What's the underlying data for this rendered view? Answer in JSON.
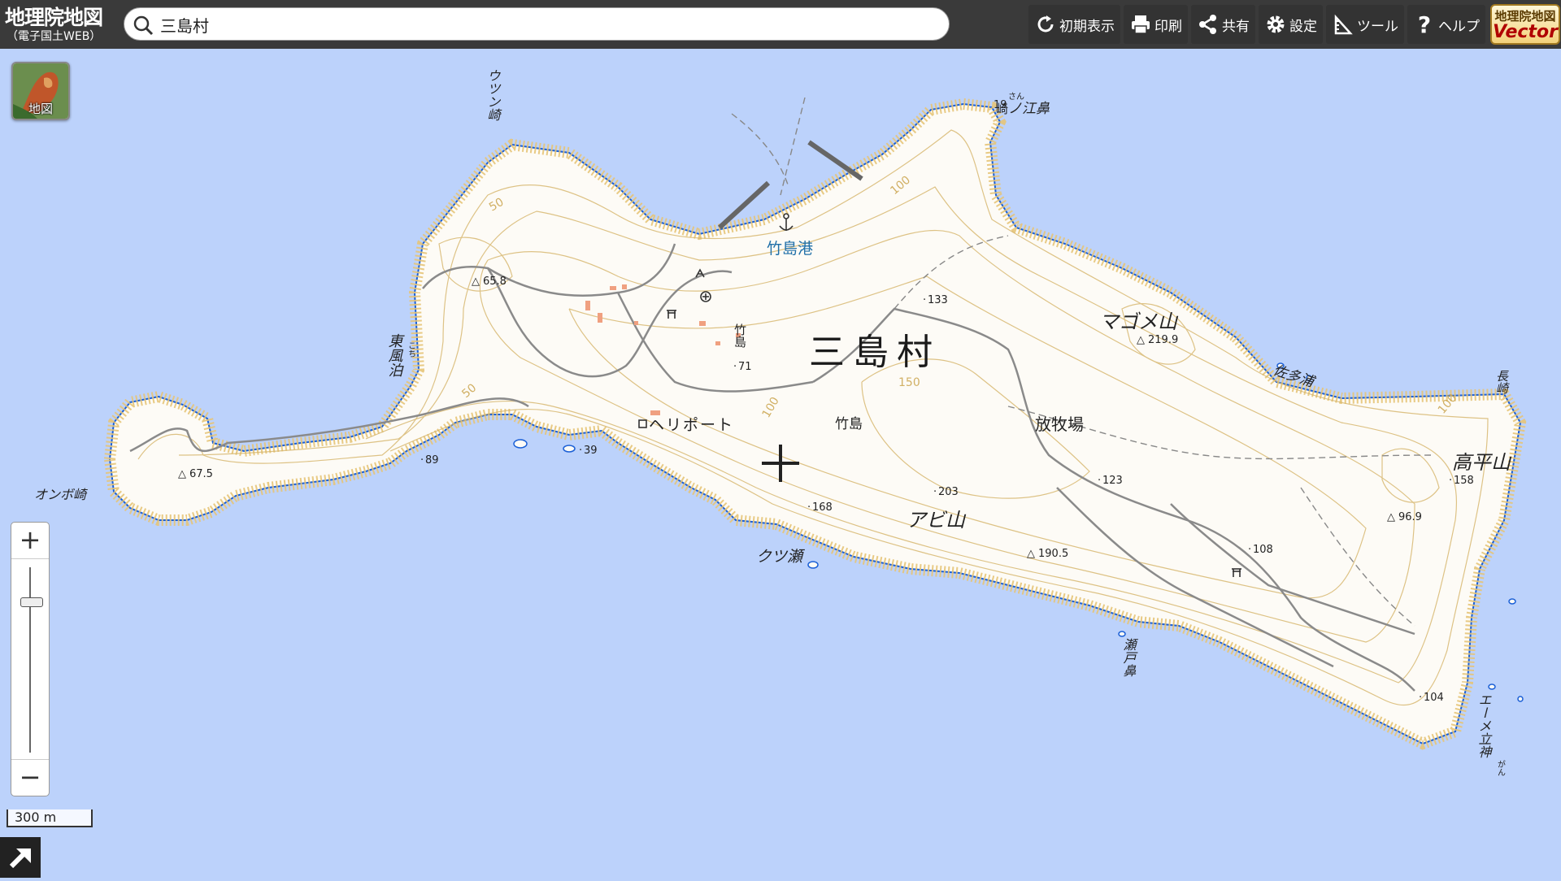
{
  "app": {
    "title": "地理院地図",
    "subtitle": "（電子国土WEB）"
  },
  "search": {
    "value": "三島村",
    "placeholder": ""
  },
  "toolbar": {
    "items": [
      {
        "label": "初期表示",
        "icon": "reload-icon"
      },
      {
        "label": "印刷",
        "icon": "printer-icon"
      },
      {
        "label": "共有",
        "icon": "share-icon"
      },
      {
        "label": "設定",
        "icon": "gear-icon"
      },
      {
        "label": "ツール",
        "icon": "ruler-icon"
      },
      {
        "label": "ヘルプ",
        "icon": "help-icon"
      }
    ],
    "vector_badge": {
      "top": "地理院地図",
      "bottom": "Vector"
    }
  },
  "layer_button": {
    "label": "地図"
  },
  "zoom": {
    "in": "+",
    "out": "−"
  },
  "scale": {
    "label": "300 m"
  },
  "map": {
    "main_label": "三島村",
    "labels": {
      "ucchinzaki": "ウツン崎",
      "eguchihana": "ノ江鼻",
      "eguchihana_prefix": "崎",
      "eguchihana_ruby": "さん",
      "eguchihana_height": "19",
      "takeshima_port": "竹島港",
      "kochidomari": "東風泊",
      "kochidomari_ruby": "こち",
      "magomeyama": "マゴメ山",
      "sataura": "佐多浦",
      "nagasaki": "長崎",
      "takeshima_village": "竹島",
      "takeshima_area": "竹島",
      "heliport": "ヘリポート",
      "bokujo": "放牧場",
      "takahirayama": "高平山",
      "onbozaki": "オンボ崎",
      "abiyama": "アビ山",
      "kutsuse": "クツ瀬",
      "setohana": "瀬戸鼻",
      "emetategami": "エーメ立神",
      "emetategami_ruby": "がん"
    },
    "spot_heights": [
      {
        "label": "65.8",
        "kind": "triangulation"
      },
      {
        "label": "133",
        "kind": "spot"
      },
      {
        "label": "219.9",
        "kind": "triangulation"
      },
      {
        "label": "71",
        "kind": "spot"
      },
      {
        "label": "89",
        "kind": "spot"
      },
      {
        "label": "67.5",
        "kind": "triangulation"
      },
      {
        "label": "39",
        "kind": "spot"
      },
      {
        "label": "168",
        "kind": "spot"
      },
      {
        "label": "203",
        "kind": "spot"
      },
      {
        "label": "190.5",
        "kind": "triangulation"
      },
      {
        "label": "123",
        "kind": "spot"
      },
      {
        "label": "158",
        "kind": "spot"
      },
      {
        "label": "96.9",
        "kind": "triangulation"
      },
      {
        "label": "108",
        "kind": "spot"
      },
      {
        "label": "104",
        "kind": "spot"
      }
    ],
    "contour_labels": [
      "50",
      "100",
      "150",
      "50",
      "100",
      "100"
    ],
    "colors": {
      "sea": "#bcd2fb",
      "land": "#fdfbf6",
      "contour": "#c9a24a",
      "cliff": "#c89b40",
      "coast": "#1a5fd6",
      "road": "#8a8a8a",
      "building": "#f0a080"
    }
  }
}
